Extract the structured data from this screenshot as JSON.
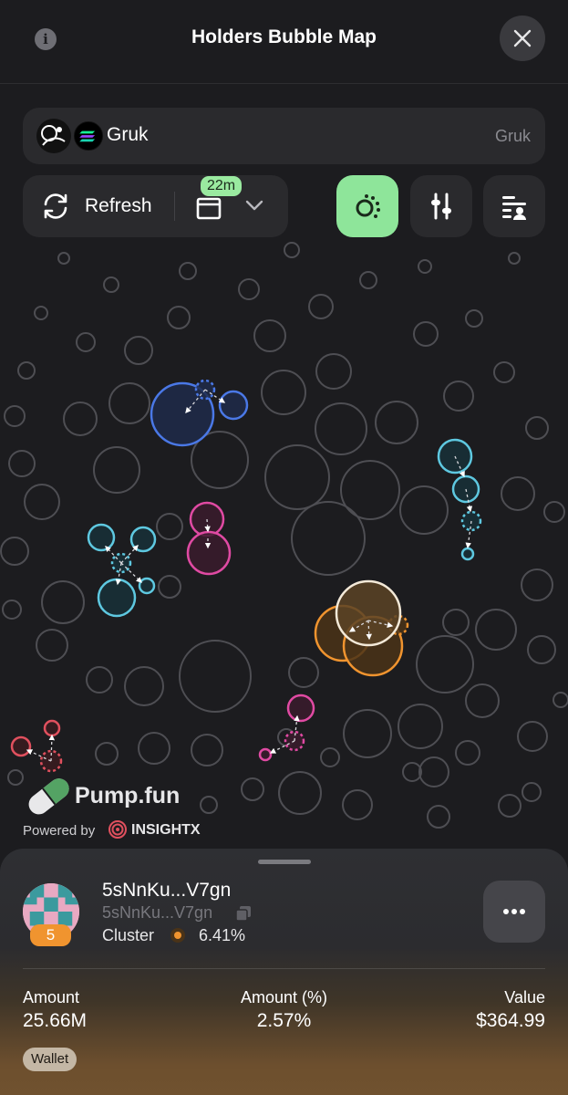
{
  "header": {
    "title": "Holders Bubble Map"
  },
  "token": {
    "name": "Gruk",
    "right_label": "Gruk"
  },
  "toolbar": {
    "refresh_label": "Refresh",
    "time_badge": "22m"
  },
  "branding": {
    "pump_label": "Pump.fun",
    "powered_by": "Powered by",
    "insight_label": "INSIGHTX"
  },
  "selected": {
    "address": "5sNnKu...V7gn",
    "address_short": "5sNnKu...V7gn",
    "cluster_number": "5",
    "cluster_label": "Cluster",
    "cluster_percent": "6.41%",
    "amount_label": "Amount",
    "amount_value": "25.66M",
    "amount_pct_label": "Amount (%)",
    "amount_pct_value": "2.57%",
    "value_label": "Value",
    "value_value": "$364.99",
    "tag": "Wallet"
  },
  "colors": {
    "accent_green": "#8ee59a",
    "cluster_blue": "#4a78e6",
    "cluster_cyan": "#5ec8e0",
    "cluster_pink": "#e04aa3",
    "cluster_orange": "#f0942f",
    "cluster_red": "#e0505e"
  },
  "icons": [
    "info-icon",
    "close-icon",
    "refresh-icon",
    "calendar-icon",
    "chevron-down-icon",
    "bubbles-icon",
    "sliders-icon",
    "list-icon",
    "copy-icon",
    "more-icon"
  ]
}
